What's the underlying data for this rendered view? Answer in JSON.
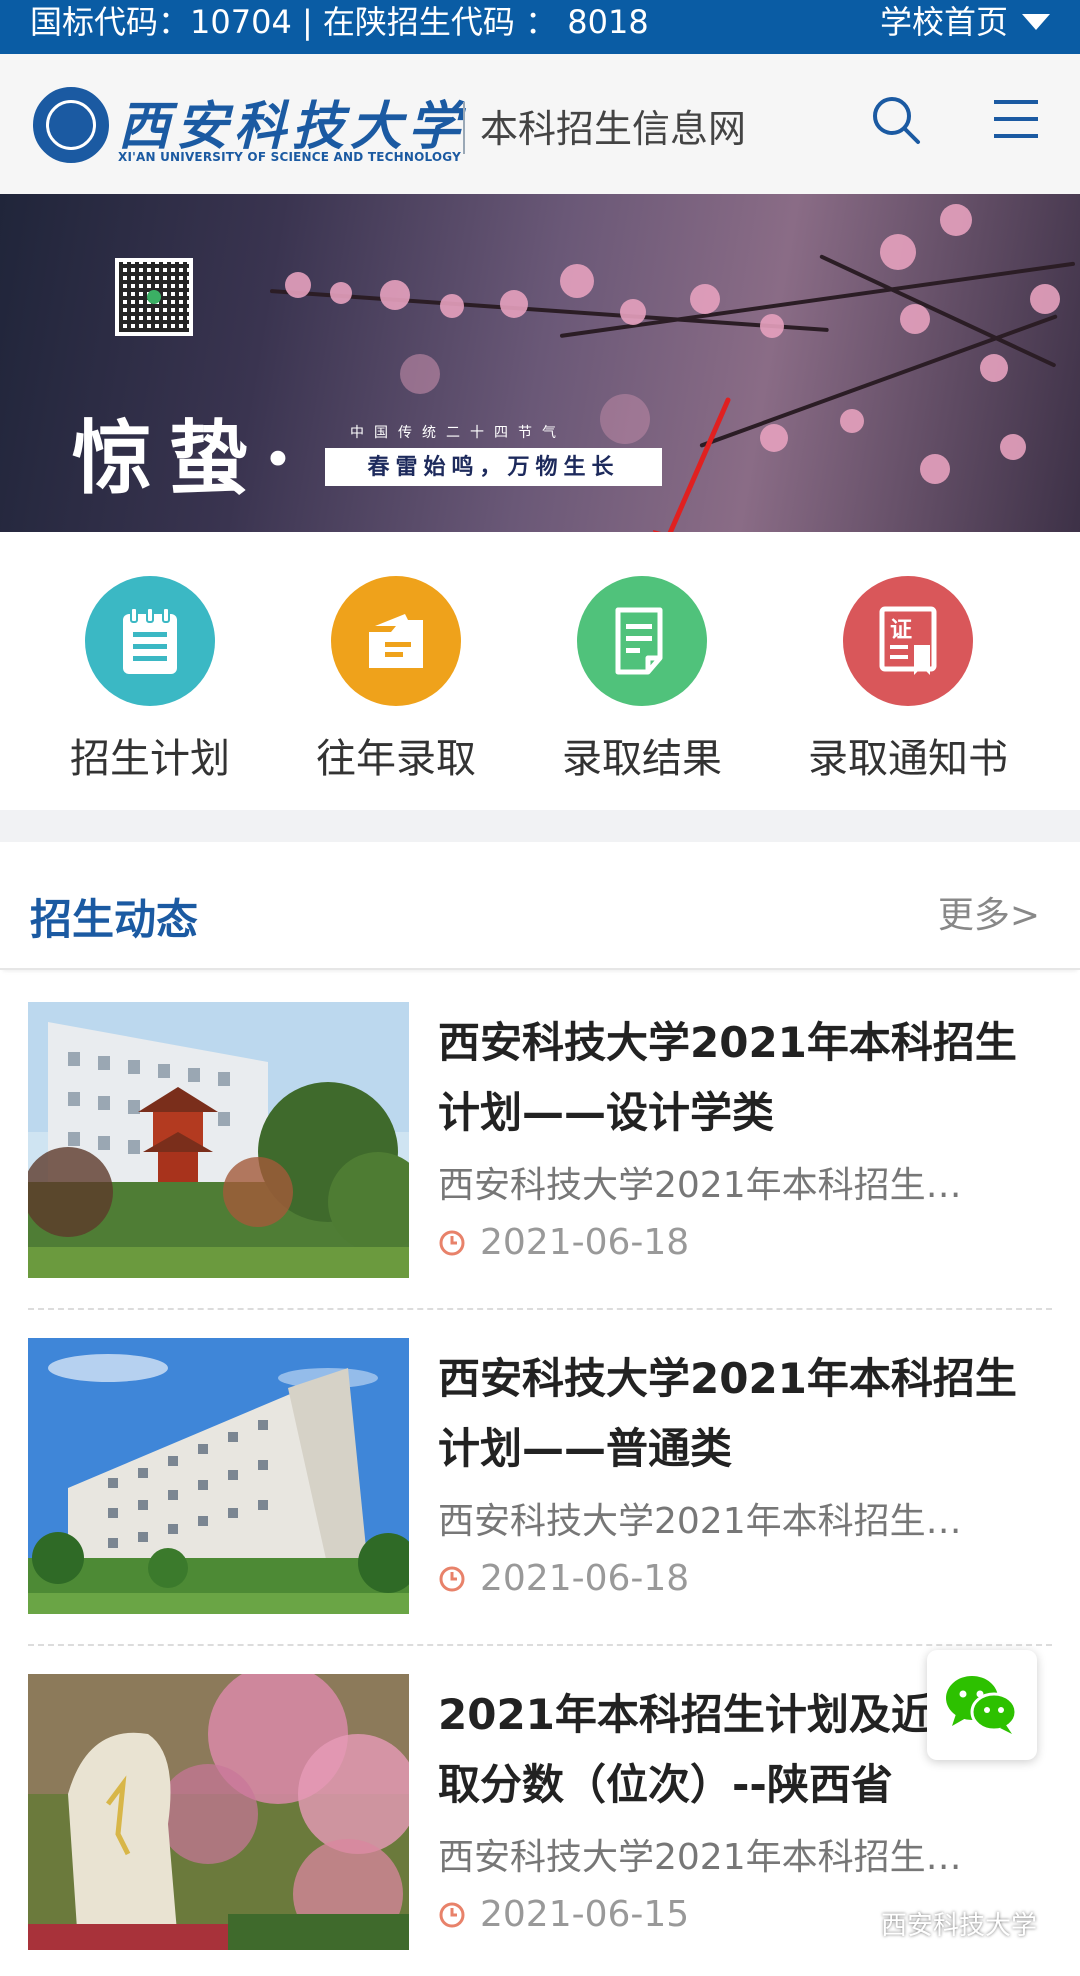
{
  "topbar": {
    "codes": "国标代码：10704 | 在陕招生代码 ： 8018",
    "home_label": "学校首页"
  },
  "header": {
    "logo_cn": "西安科技大学",
    "logo_en": "XI'AN UNIVERSITY OF SCIENCE AND TECHNOLOGY",
    "site_name": "本科招生信息网"
  },
  "banner": {
    "title": "惊蛰·",
    "subtitle": "中国传统二十四节气",
    "tagline": "春雷始鸣，万物生长"
  },
  "quicknav": [
    {
      "label": "招生计划",
      "color": "#3bb8c4",
      "icon": "clipboard-icon"
    },
    {
      "label": "往年录取",
      "color": "#efa21b",
      "icon": "folder-icon"
    },
    {
      "label": "录取结果",
      "color": "#50c27b",
      "icon": "document-icon"
    },
    {
      "label": "录取通知书",
      "color": "#d9575a",
      "icon": "certificate-icon"
    }
  ],
  "news": {
    "title": "招生动态",
    "more": "更多>",
    "items": [
      {
        "title": "西安科技大学2021年本科招生计划——设计学类",
        "desc": "西安科技大学2021年本科招生…",
        "date": "2021-06-18"
      },
      {
        "title": "西安科技大学2021年本科招生计划——普通类",
        "desc": "西安科技大学2021年本科招生…",
        "date": "2021-06-18"
      },
      {
        "title": "2021年本科招生计划及近年录取分数（位次）--陕西省",
        "desc": "西安科技大学2021年本科招生…",
        "date": "2021-06-15"
      }
    ]
  },
  "watermark": "西安科技大学",
  "colors": {
    "brand": "#0a5ca4",
    "accent": "#1b5aa2"
  }
}
